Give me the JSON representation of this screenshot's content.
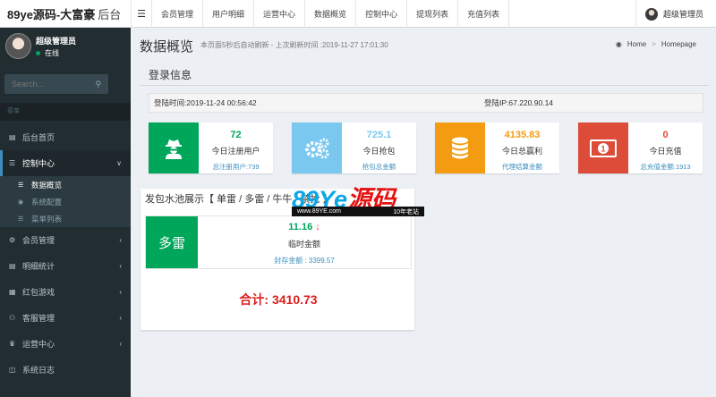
{
  "brand": {
    "name": "89ye源码-大富豪",
    "suffix": "后台"
  },
  "topnav": {
    "menu_icon": "hamburger-icon",
    "items": [
      "会员管理",
      "用户明细",
      "运营中心",
      "数据概览",
      "控制中心",
      "提现列表",
      "充值列表"
    ]
  },
  "topuser": {
    "name": "超级管理员"
  },
  "sidebar": {
    "user": {
      "name": "超级管理员",
      "status": "在线"
    },
    "search": {
      "placeholder": "Search..."
    },
    "menu_header": "菜单",
    "items": [
      {
        "label": "后台首页",
        "icon": "bar-chart-icon"
      },
      {
        "label": "控制中心",
        "icon": "list-icon"
      },
      {
        "label": "会员管理",
        "icon": "gear-icon"
      },
      {
        "label": "明细统计",
        "icon": "bar-chart-icon"
      },
      {
        "label": "红包游戏",
        "icon": "table-icon"
      },
      {
        "label": "客服管理",
        "icon": "users-icon"
      },
      {
        "label": "运营中心",
        "icon": "trophy-icon"
      },
      {
        "label": "系统日志",
        "icon": "database-icon"
      }
    ],
    "submenu": [
      {
        "label": "数据概览",
        "icon": "list-icon"
      },
      {
        "label": "系统配置",
        "icon": "toggle-icon"
      },
      {
        "label": "菜单列表",
        "icon": "list-icon"
      }
    ]
  },
  "header": {
    "title": "数据概览",
    "desc": "本页面5秒后自动刷新 - 上次刷新时间 :2019-11-27 17:01:30",
    "breadcrumb": {
      "home": "Home",
      "current": "Homepage"
    }
  },
  "login": {
    "title": "登录信息",
    "time": "登陆时间:2019-11-24 00:56:42",
    "ip": "登陆IP:67.220.90.14"
  },
  "stats": [
    {
      "value": "72",
      "label": "今日注册用户",
      "foot": "总注册用户:739",
      "color": "#00a65a",
      "icon": "spy-icon"
    },
    {
      "value": "725.1",
      "label": "今日抢包",
      "foot": "抢包总金额",
      "color": "#7ac8f0",
      "icon": "gears-icon"
    },
    {
      "value": "4135.83",
      "label": "今日总赢利",
      "foot": "代理结算金额",
      "color": "#f39c12",
      "icon": "database-icon"
    },
    {
      "value": "0",
      "label": "今日充值",
      "foot": "总充值金额:1913",
      "color": "#dd4b39",
      "icon": "money-icon"
    }
  ],
  "pool": {
    "title": "发包水池展示【 单雷 / 多雷 / 牛牛 / 禁抢 】",
    "card": {
      "name": "多雷",
      "value": "11.16",
      "arrow": "↓",
      "label": "临时金额",
      "foot": "封存金额 : 3399.57"
    },
    "total": "合计:  3410.73"
  },
  "watermark": {
    "logo_a": "89Ye",
    "logo_b": "源码",
    "url": "www.89YE.com",
    "tag": "10年老站"
  }
}
